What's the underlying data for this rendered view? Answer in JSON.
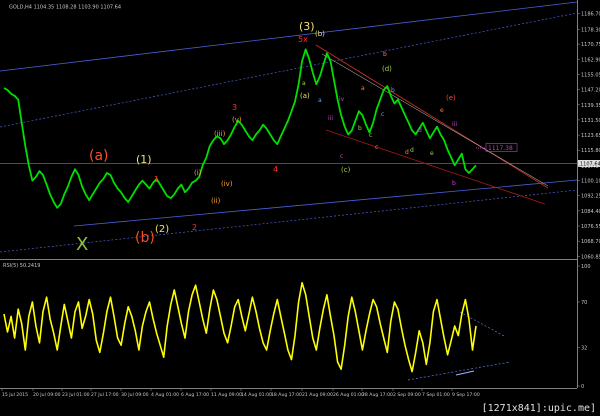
{
  "chart_data": [
    {
      "type": "line",
      "panel": "price",
      "title": "GOLD,H4  1104.35 1108.28 1103.90 1107.64",
      "ylim": [
        1060,
        1191
      ],
      "y_ticks": [
        "1186.70",
        "1178.30",
        "1170.75",
        "1162.90",
        "1155.05",
        "1147.20",
        "1139.35",
        "1131.50",
        "1123.65",
        "1115.80",
        "1107.64",
        "1100.10",
        "1092.25",
        "1084.40",
        "1076.55",
        "1068.70",
        "1060.85"
      ],
      "current_price_label": "1107.64",
      "level_label": "1117.38",
      "series": [
        {
          "values": [
            1148,
            1147,
            1145,
            1144,
            1142,
            1130,
            1118,
            1108,
            1100,
            1102,
            1105,
            1103,
            1098,
            1093,
            1089,
            1086,
            1088,
            1093,
            1097,
            1102,
            1106,
            1103,
            1097,
            1093,
            1090,
            1093,
            1096,
            1099,
            1101,
            1104,
            1103,
            1099,
            1096,
            1094,
            1091,
            1089,
            1092,
            1095,
            1098,
            1100,
            1098,
            1096,
            1099,
            1101,
            1098,
            1095,
            1092,
            1091,
            1093,
            1096,
            1098,
            1094,
            1096,
            1099,
            1100,
            1102,
            1108,
            1112,
            1118,
            1121,
            1123,
            1122,
            1119,
            1121,
            1124,
            1128,
            1131,
            1129,
            1126,
            1123,
            1121,
            1124,
            1126,
            1129,
            1127,
            1124,
            1121,
            1119,
            1123,
            1127,
            1131,
            1136,
            1141,
            1150,
            1162,
            1168,
            1163,
            1156,
            1150,
            1154,
            1160,
            1166,
            1162,
            1152,
            1142,
            1134,
            1128,
            1124,
            1126,
            1131,
            1136,
            1134,
            1129,
            1125,
            1130,
            1137,
            1142,
            1147,
            1149,
            1144,
            1140,
            1142,
            1138,
            1134,
            1130,
            1126,
            1124,
            1127,
            1130,
            1126,
            1122,
            1125,
            1128,
            1124,
            1121,
            1116,
            1112,
            1108,
            1111,
            1114,
            1106,
            1104,
            1106,
            1108
          ]
        }
      ],
      "wave_labels": [
        {
          "text": "X",
          "color": "#8ec43a"
        },
        {
          "text": "(a)",
          "color": "#ff4b1e"
        },
        {
          "text": "(b)",
          "color": "#ff4b1e"
        },
        {
          "text": "(1)",
          "color": "#f0e070"
        },
        {
          "text": "(2)",
          "color": "#f0e070"
        },
        {
          "text": "(3)",
          "color": "#f0e070"
        },
        {
          "text": "1",
          "color": "#ff3030"
        },
        {
          "text": "2",
          "color": "#ff3030"
        },
        {
          "text": "3",
          "color": "#ff3030"
        },
        {
          "text": "4",
          "color": "#ff3030"
        },
        {
          "text": "5x",
          "color": "#ff3030"
        },
        {
          "text": "(i)",
          "color": "#ffa030"
        },
        {
          "text": "(ii)",
          "color": "#ffa030"
        },
        {
          "text": "(iii)",
          "color": "#ffa030"
        },
        {
          "text": "(iv)",
          "color": "#ffa030"
        },
        {
          "text": "(v)",
          "color": "#ffa030"
        },
        {
          "text": "(a)",
          "color": "#f0e070"
        },
        {
          "text": "(b)",
          "color": "#f0e070"
        },
        {
          "text": "(c)",
          "color": "#9fd04a"
        },
        {
          "text": "(d)",
          "color": "#9fd04a"
        },
        {
          "text": "(e)",
          "color": "#ff4040"
        },
        {
          "text": "a",
          "color": "#40b0ff"
        },
        {
          "text": "b",
          "color": "#40b0ff"
        },
        {
          "text": "c",
          "color": "#40b0ff"
        },
        {
          "text": "a",
          "color": "#ff8040"
        },
        {
          "text": "b",
          "color": "#ff8040"
        },
        {
          "text": "c",
          "color": "#ff8040"
        },
        {
          "text": "d",
          "color": "#ff8040"
        },
        {
          "text": "e",
          "color": "#ff8040"
        },
        {
          "text": "a",
          "color": "#9fd04a"
        },
        {
          "text": "b",
          "color": "#9fd04a"
        },
        {
          "text": "c",
          "color": "#9fd04a"
        },
        {
          "text": "d",
          "color": "#9fd04a"
        },
        {
          "text": "e",
          "color": "#9fd04a"
        },
        {
          "text": "iv",
          "color": "#d040d0"
        },
        {
          "text": "iii",
          "color": "#d040d0"
        },
        {
          "text": "iii",
          "color": "#d040d0"
        },
        {
          "text": "c",
          "color": "#d040d0"
        },
        {
          "text": "d",
          "color": "#d040d0"
        },
        {
          "text": "b",
          "color": "#d040d0"
        }
      ]
    },
    {
      "type": "line",
      "panel": "indicator",
      "title": "RSI(5) 50.2419",
      "ylim": [
        0,
        100
      ],
      "y_ticks": [
        "100",
        "70",
        "32",
        "0"
      ],
      "series": [
        {
          "values": [
            60,
            45,
            58,
            40,
            64,
            52,
            30,
            58,
            70,
            50,
            36,
            62,
            74,
            56,
            44,
            30,
            50,
            68,
            54,
            40,
            62,
            70,
            48,
            58,
            72,
            60,
            38,
            28,
            44,
            62,
            74,
            58,
            40,
            34,
            52,
            66,
            58,
            46,
            30,
            50,
            62,
            70,
            56,
            44,
            34,
            24,
            50,
            68,
            80,
            66,
            52,
            40,
            62,
            76,
            84,
            70,
            56,
            44,
            64,
            80,
            72,
            58,
            44,
            36,
            50,
            66,
            72,
            58,
            46,
            60,
            74,
            62,
            48,
            36,
            30,
            46,
            60,
            72,
            58,
            44,
            30,
            22,
            42,
            70,
            86,
            76,
            58,
            40,
            30,
            48,
            64,
            76,
            58,
            42,
            20,
            14,
            34,
            58,
            74,
            62,
            46,
            30,
            46,
            60,
            72,
            66,
            52,
            40,
            28,
            54,
            70,
            64,
            48,
            34,
            22,
            12,
            28,
            46,
            36,
            18,
            36,
            62,
            72,
            56,
            40,
            26,
            38,
            50,
            42,
            60,
            72,
            56,
            30,
            50
          ]
        }
      ]
    }
  ],
  "x_ticks": [
    "15 Jul 2015",
    "20 Jul 09:00",
    "23 Jul 01:00",
    "27 Jul 17:00",
    "30 Jul 09:00",
    "4 Aug 01:00",
    "6 Aug 17:00",
    "11 Aug 09:00",
    "14 Aug 01:00",
    "18 Aug 17:00",
    "21 Aug 09:00",
    "26 Aug 01:00",
    "28 Aug 17:00",
    "2 Sep 09:00",
    "7 Sep 01:00",
    "9 Sep 17:00"
  ],
  "watermark": "[1271x841]:upic.me]",
  "colors": {
    "background": "#000000",
    "price_line": "#00e000",
    "rsi_line": "#ffff00",
    "channel_blue": "#4a5fd8",
    "channel_dotted": "#4a5fd8",
    "trend_red": "#c03020",
    "trend_maroon": "#a01818",
    "level_magenta": "#c040c0",
    "axis_text": "#c8c8c8",
    "separator": "#808080"
  }
}
